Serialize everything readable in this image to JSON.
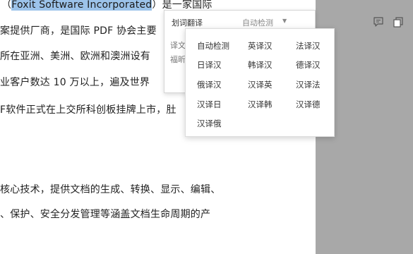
{
  "document": {
    "line1_prefix": "（",
    "line1_selected": "Foxit Software Incorporated",
    "line1_suffix": "）是一家国际",
    "line2": "案提供厂商，是国际 PDF 协会主要",
    "line3": "所在亚洲、美洲、欧洲和澳洲设有",
    "line4": "业客户数达 10 万以上，遍及世界",
    "line5": "F软件正式在上交所科创板挂牌上市，肚",
    "line6": "核心技术，提供文档的生成、转换、显示、编辑、",
    "line7": "、保护、安全分发管理等涵盖文档生命周期的产"
  },
  "popup": {
    "title": "划词翻译",
    "language": "自动检测",
    "caret": "▼",
    "body_line1": "译文",
    "body_line2": "福昕"
  },
  "icons": {
    "comment": "comment-icon",
    "copy": "copy-icon"
  },
  "dropdown": {
    "options": [
      "自动检测",
      "英译汉",
      "法译汉",
      "日译汉",
      "韩译汉",
      "德译汉",
      "俄译汉",
      "汉译英",
      "汉译法",
      "汉译日",
      "汉译韩",
      "汉译德",
      "汉译俄"
    ]
  }
}
